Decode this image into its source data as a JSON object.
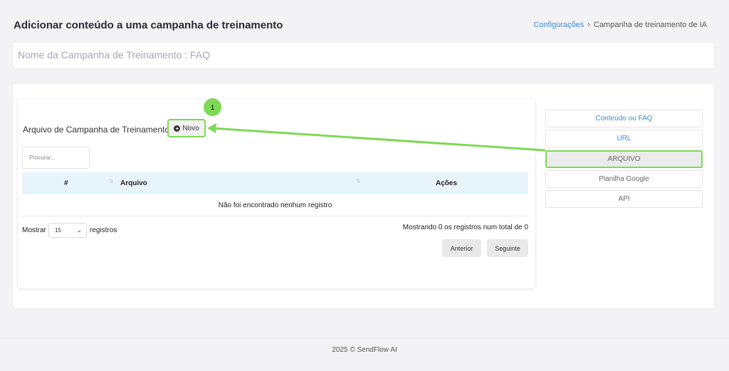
{
  "header": {
    "title": "Adicionar conteúdo a uma campanha de treinamento",
    "breadcrumb": {
      "link": "Configurações",
      "separator": "›",
      "current": "Campanha de treinamento de IA"
    }
  },
  "campaign_name": "Nome da Campanha de Treinamento : FAQ",
  "file_section": {
    "title": "Arquivo de Campanha de Treinamento",
    "new_button": "Novo",
    "step_badge": "1",
    "search_placeholder": "Procurar...",
    "table": {
      "columns": [
        "#",
        "Arquivo",
        "Ações"
      ],
      "empty_message": "Não foi encontrado nenhum registro"
    },
    "length": {
      "prefix": "Mostrar",
      "value": "15",
      "suffix": "registros"
    },
    "info": "Mostrando 0 os registros num total de 0",
    "pagination": {
      "previous": "Anterior",
      "next": "Seguinte"
    }
  },
  "content_types": {
    "items": [
      "Conteúdo ou FAQ",
      "URL",
      "ARQUIVO",
      "Planilha Google",
      "API"
    ],
    "active": "ARQUIVO"
  },
  "footer": "2025 © SendFlow AI",
  "colors": {
    "accent": "#3a8fd8",
    "highlight": "#7ed957",
    "table_header": "#e8f4fc",
    "background": "#f3f3f6"
  }
}
